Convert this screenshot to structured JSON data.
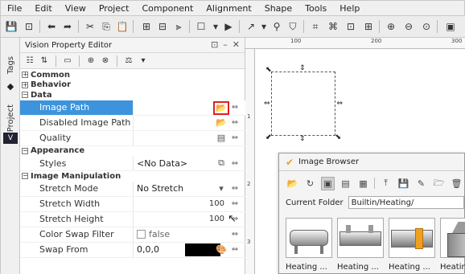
{
  "menu": [
    "File",
    "Edit",
    "View",
    "Project",
    "Component",
    "Alignment",
    "Shape",
    "Tools",
    "Help"
  ],
  "side_tabs": {
    "tags": "Tags",
    "project": "Project"
  },
  "property_editor": {
    "title": "Vision Property Editor",
    "window_controls": {
      "restore": "⊡",
      "minimize": "–",
      "close": "✕"
    },
    "groups": {
      "common": "Common",
      "behavior": "Behavior",
      "data": "Data",
      "appearance": "Appearance",
      "image_manipulation": "Image Manipulation"
    },
    "props": {
      "image_path": {
        "name": "Image Path",
        "value": ""
      },
      "disabled_image_path": {
        "name": "Disabled Image Path",
        "value": ""
      },
      "quality": {
        "name": "Quality",
        "value": ""
      },
      "styles": {
        "name": "Styles",
        "value": "<No Data>"
      },
      "stretch_mode": {
        "name": "Stretch Mode",
        "value": "No Stretch"
      },
      "stretch_width": {
        "name": "Stretch Width",
        "value": "100"
      },
      "stretch_height": {
        "name": "Stretch Height",
        "value": "100"
      },
      "color_swap_filter": {
        "name": "Color Swap Filter",
        "value": "false"
      },
      "swap_from": {
        "name": "Swap From",
        "value": "0,0,0",
        "color": "#000000"
      }
    }
  },
  "rulers": {
    "top": [
      "100",
      "200",
      "300"
    ],
    "left": [
      "1",
      "2",
      "3"
    ]
  },
  "image_browser": {
    "title": "Image Browser",
    "folder_label": "Current Folder",
    "folder_value": "Builtin/Heating/",
    "thumbnails": [
      "Heating ...",
      "Heating ...",
      "Heating ...",
      "Heating ..."
    ]
  },
  "colors": {
    "selection": "#3d94dc",
    "highlight_box": "#e02020",
    "swap_from": "#000000"
  }
}
